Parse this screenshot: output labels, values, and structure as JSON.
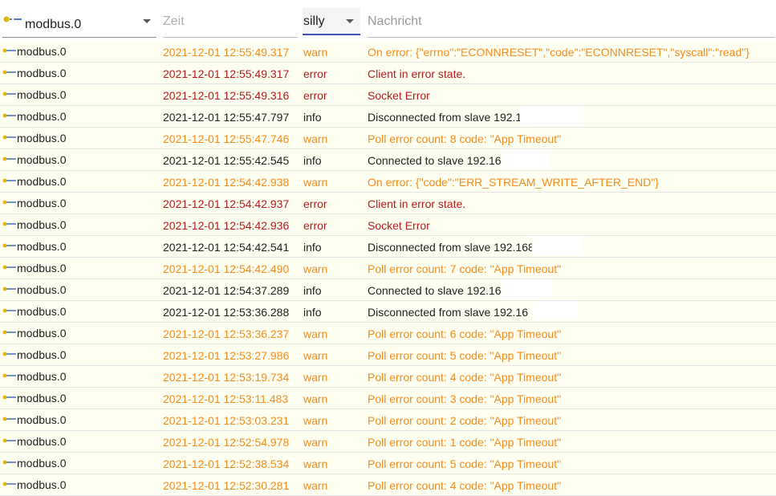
{
  "filters": {
    "source_value": "modbus.0",
    "time_placeholder": "Zeit",
    "level_value": "silly",
    "message_placeholder": "Nachricht"
  },
  "rows": [
    {
      "source": "modbus.0",
      "time": "2021-12-01 12:55:49.317",
      "level": "warn",
      "message": "On error: {\"errno\":\"ECONNRESET\",\"code\":\"ECONNRESET\",\"syscall\":\"read\"}"
    },
    {
      "source": "modbus.0",
      "time": "2021-12-01 12:55:49.317",
      "level": "error",
      "message": "Client in error state."
    },
    {
      "source": "modbus.0",
      "time": "2021-12-01 12:55:49.316",
      "level": "error",
      "message": "Socket Error"
    },
    {
      "source": "modbus.0",
      "time": "2021-12-01 12:55:47.797",
      "level": "info",
      "message": "Disconnected from slave 192.16"
    },
    {
      "source": "modbus.0",
      "time": "2021-12-01 12:55:47.746",
      "level": "warn",
      "message": "Poll error count: 8 code: \"App Timeout\""
    },
    {
      "source": "modbus.0",
      "time": "2021-12-01 12:55:42.545",
      "level": "info",
      "message": "Connected to slave 192.16"
    },
    {
      "source": "modbus.0",
      "time": "2021-12-01 12:54:42.938",
      "level": "warn",
      "message": "On error: {\"code\":\"ERR_STREAM_WRITE_AFTER_END\"}"
    },
    {
      "source": "modbus.0",
      "time": "2021-12-01 12:54:42.937",
      "level": "error",
      "message": "Client in error state."
    },
    {
      "source": "modbus.0",
      "time": "2021-12-01 12:54:42.936",
      "level": "error",
      "message": "Socket Error"
    },
    {
      "source": "modbus.0",
      "time": "2021-12-01 12:54:42.541",
      "level": "info",
      "message": "Disconnected from slave 192.168"
    },
    {
      "source": "modbus.0",
      "time": "2021-12-01 12:54:42.490",
      "level": "warn",
      "message": "Poll error count: 7 code: \"App Timeout\""
    },
    {
      "source": "modbus.0",
      "time": "2021-12-01 12:54:37.289",
      "level": "info",
      "message": "Connected to slave 192.16"
    },
    {
      "source": "modbus.0",
      "time": "2021-12-01 12:53:36.288",
      "level": "info",
      "message": "Disconnected from slave 192.16"
    },
    {
      "source": "modbus.0",
      "time": "2021-12-01 12:53:36.237",
      "level": "warn",
      "message": "Poll error count: 6 code: \"App Timeout\""
    },
    {
      "source": "modbus.0",
      "time": "2021-12-01 12:53:27.986",
      "level": "warn",
      "message": "Poll error count: 5 code: \"App Timeout\""
    },
    {
      "source": "modbus.0",
      "time": "2021-12-01 12:53:19.734",
      "level": "warn",
      "message": "Poll error count: 4 code: \"App Timeout\""
    },
    {
      "source": "modbus.0",
      "time": "2021-12-01 12:53:11.483",
      "level": "warn",
      "message": "Poll error count: 3 code: \"App Timeout\""
    },
    {
      "source": "modbus.0",
      "time": "2021-12-01 12:53:03.231",
      "level": "warn",
      "message": "Poll error count: 2 code: \"App Timeout\""
    },
    {
      "source": "modbus.0",
      "time": "2021-12-01 12:52:54.978",
      "level": "warn",
      "message": "Poll error count: 1 code: \"App Timeout\""
    },
    {
      "source": "modbus.0",
      "time": "2021-12-01 12:52:38.534",
      "level": "warn",
      "message": "Poll error count: 5 code: \"App Timeout\""
    },
    {
      "source": "modbus.0",
      "time": "2021-12-01 12:52:30.281",
      "level": "warn",
      "message": "Poll error count: 4 code: \"App Timeout\""
    }
  ],
  "colors": {
    "warn": "#f28c1e",
    "error": "#b51c1c",
    "info": "#222222",
    "row_background": "#fefef1",
    "level_underline": "#3f51b5"
  },
  "icons": {
    "adapter": "modbus-adapter-icon",
    "dropdown": "chevron-down-icon"
  }
}
